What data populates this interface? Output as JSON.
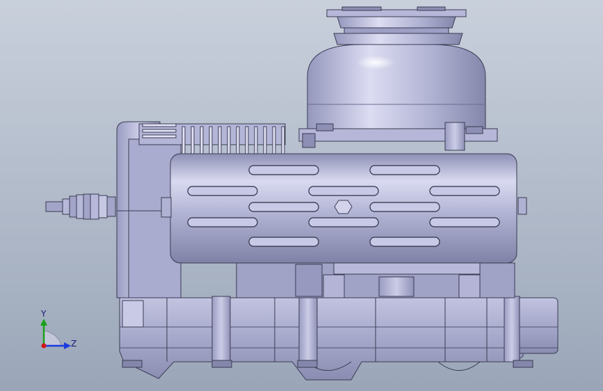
{
  "viewport": {
    "background_top": "#c9d0dc",
    "background_bottom": "#9aa6b8"
  },
  "model": {
    "body_color": "#a9abcf",
    "body_light": "#d6d7ee",
    "body_dark": "#6f7196",
    "edge_color": "#3a3b52"
  },
  "triad": {
    "y_label": "Y",
    "z_label": "Z",
    "y_color": "#18a018",
    "z_color": "#1a3adf",
    "origin_color": "#d01818"
  }
}
